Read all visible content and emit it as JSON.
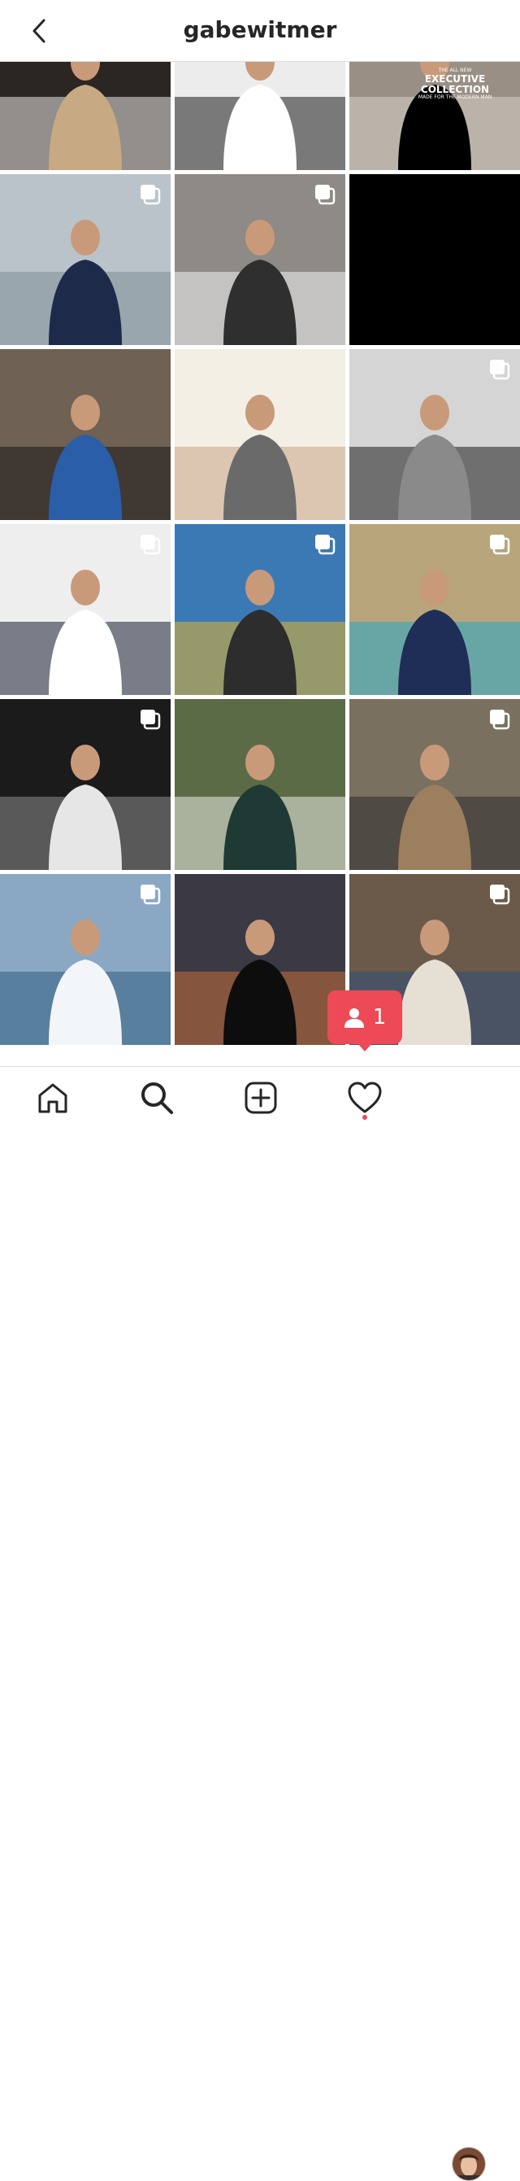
{
  "header": {
    "title": "gabewitmer",
    "back_icon": "chevron-left-icon"
  },
  "grid": {
    "tiles": [
      {
        "name": "post-1",
        "palette": [
          "#2b2622",
          "#e8e6e3",
          "#c7a983"
        ],
        "multi": false,
        "overlay_lines": []
      },
      {
        "name": "post-2",
        "palette": [
          "#ececec",
          "#1b1b1b",
          "#ffffff"
        ],
        "multi": false,
        "overlay_lines": []
      },
      {
        "name": "post-3",
        "palette": [
          "#9a8f84",
          "#d7d1c8",
          "#000000"
        ],
        "multi": false,
        "overlay_lines": [
          "THE ALL NEW",
          "EXECUTIVE",
          "COLLECTION",
          "MADE FOR THE MODERN MAN"
        ]
      },
      {
        "name": "post-4",
        "palette": [
          "#b9c3c9",
          "#7f8e96",
          "#1e2a4a"
        ],
        "multi": true,
        "overlay_lines": []
      },
      {
        "name": "post-5",
        "palette": [
          "#8e8a86",
          "#f3f3f3",
          "#2f2f2f"
        ],
        "multi": true,
        "overlay_lines": []
      },
      {
        "name": "post-6",
        "palette": [
          "#000000",
          "#000000",
          "#000000"
        ],
        "multi": false,
        "overlay_lines": []
      },
      {
        "name": "post-7",
        "palette": [
          "#6f6153",
          "#1a1a1a",
          "#2a5ea8"
        ],
        "multi": false,
        "overlay_lines": []
      },
      {
        "name": "post-8",
        "palette": [
          "#f4efe4",
          "#c9a286",
          "#6a6a6a"
        ],
        "multi": false,
        "overlay_lines": []
      },
      {
        "name": "post-9",
        "palette": [
          "#d5d5d5",
          "#1c1c1c",
          "#8a8a8a"
        ],
        "multi": true,
        "overlay_lines": []
      },
      {
        "name": "post-10",
        "palette": [
          "#eeeeee",
          "#1a2033",
          "#ffffff"
        ],
        "multi": true,
        "overlay_lines": []
      },
      {
        "name": "post-11",
        "palette": [
          "#3b79b5",
          "#e2b42a",
          "#2d2d2d"
        ],
        "multi": true,
        "overlay_lines": []
      },
      {
        "name": "post-12",
        "palette": [
          "#b9a57c",
          "#27a7c7",
          "#1f2e56"
        ],
        "multi": true,
        "overlay_lines": []
      },
      {
        "name": "post-13",
        "palette": [
          "#1b1b1b",
          "#8d8d8d",
          "#e6e6e6"
        ],
        "multi": true,
        "overlay_lines": []
      },
      {
        "name": "post-14",
        "palette": [
          "#5a6b45",
          "#ecebe6",
          "#1f3a34"
        ],
        "multi": false,
        "overlay_lines": []
      },
      {
        "name": "post-15",
        "palette": [
          "#7a7060",
          "#2b2b2b",
          "#9c7f5e"
        ],
        "multi": true,
        "overlay_lines": []
      },
      {
        "name": "post-16",
        "palette": [
          "#8aa8c4",
          "#2f5e80",
          "#f3f6f8"
        ],
        "multi": true,
        "overlay_lines": []
      },
      {
        "name": "post-17",
        "palette": [
          "#3b3a44",
          "#c46b3a",
          "#0d0d0d"
        ],
        "multi": false,
        "overlay_lines": []
      },
      {
        "name": "post-18",
        "palette": [
          "#6b5a4a",
          "#2f4f7a",
          "#e6dfd3"
        ],
        "multi": true,
        "overlay_lines": []
      }
    ]
  },
  "notification": {
    "count": "1",
    "icon": "person-icon",
    "color": "#ed4956"
  },
  "tabbar": {
    "items": [
      {
        "name": "tab-home",
        "icon": "home-icon"
      },
      {
        "name": "tab-search",
        "icon": "search-icon"
      },
      {
        "name": "tab-new-post",
        "icon": "plus-square-icon"
      },
      {
        "name": "tab-activity",
        "icon": "heart-icon"
      },
      {
        "name": "tab-profile",
        "icon": "avatar"
      }
    ]
  }
}
